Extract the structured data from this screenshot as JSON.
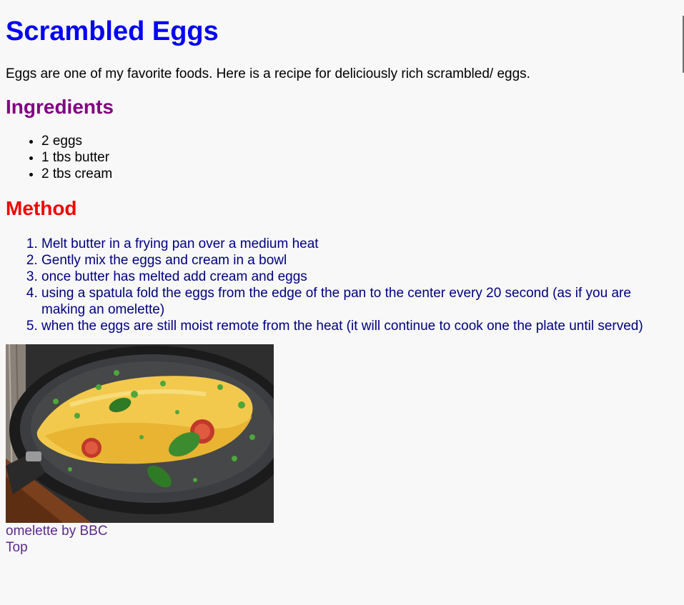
{
  "page": {
    "title": "Scrambled Eggs",
    "intro": "Eggs are one of my favorite foods. Here is a recipe for deliciously rich scrambled/ eggs.",
    "ingredients_heading": "Ingredients",
    "ingredients": [
      "2 eggs",
      "1 tbs butter",
      "2 tbs cream"
    ],
    "method_heading": "Method",
    "method": [
      "Melt butter in a frying pan over a medium heat",
      "Gently mix the eggs and cream in a bowl",
      "once butter has melted add cream and eggs",
      "using a spatula fold the eggs from the edge of the pan to the center every 20 second (as if you are making an omelette)",
      "when the eggs are still moist remote from the heat (it will continue to cook one the plate until served)"
    ],
    "caption_link": "omelette by BBC",
    "top_link": "Top"
  },
  "colors": {
    "title": "#0000f2",
    "ingredients_heading": "#800080",
    "method_heading": "#ef0000",
    "method_text": "#000080",
    "link": "#5c2a8c",
    "background": "#f8f8f8"
  },
  "icons": {
    "photo": "omelette-photo"
  }
}
